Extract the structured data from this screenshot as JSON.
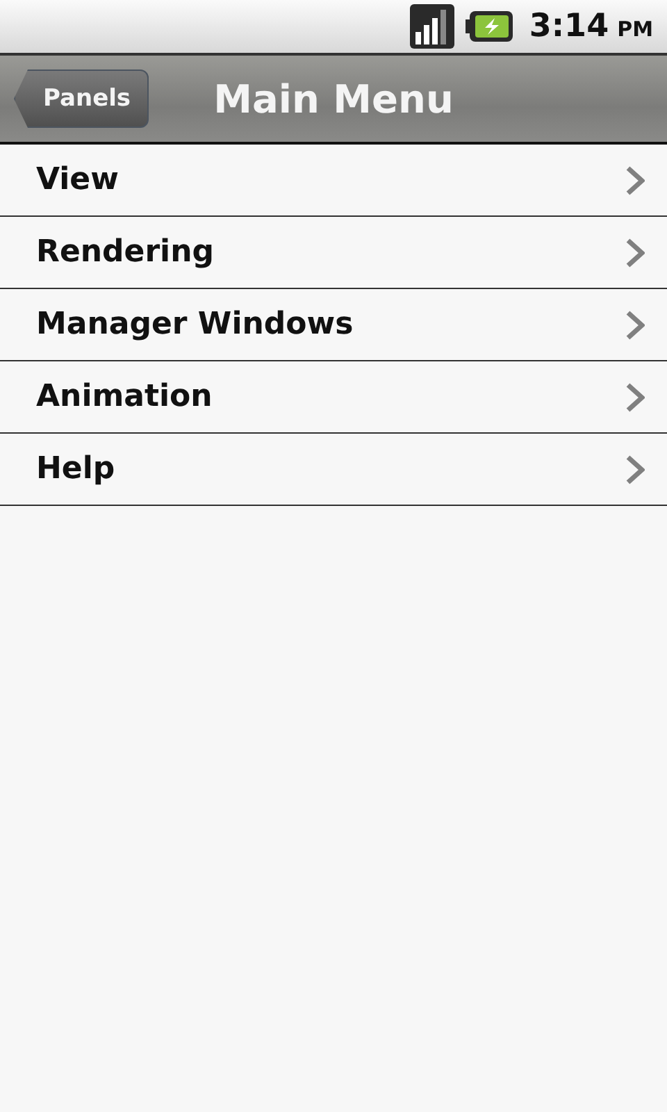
{
  "status_bar": {
    "time": "3:14",
    "ampm": "PM"
  },
  "nav_bar": {
    "back_button": "Panels",
    "title": "Main Menu"
  },
  "menu_items": [
    {
      "label": "View"
    },
    {
      "label": "Rendering"
    },
    {
      "label": "Manager Windows"
    },
    {
      "label": "Animation"
    },
    {
      "label": "Help"
    }
  ]
}
